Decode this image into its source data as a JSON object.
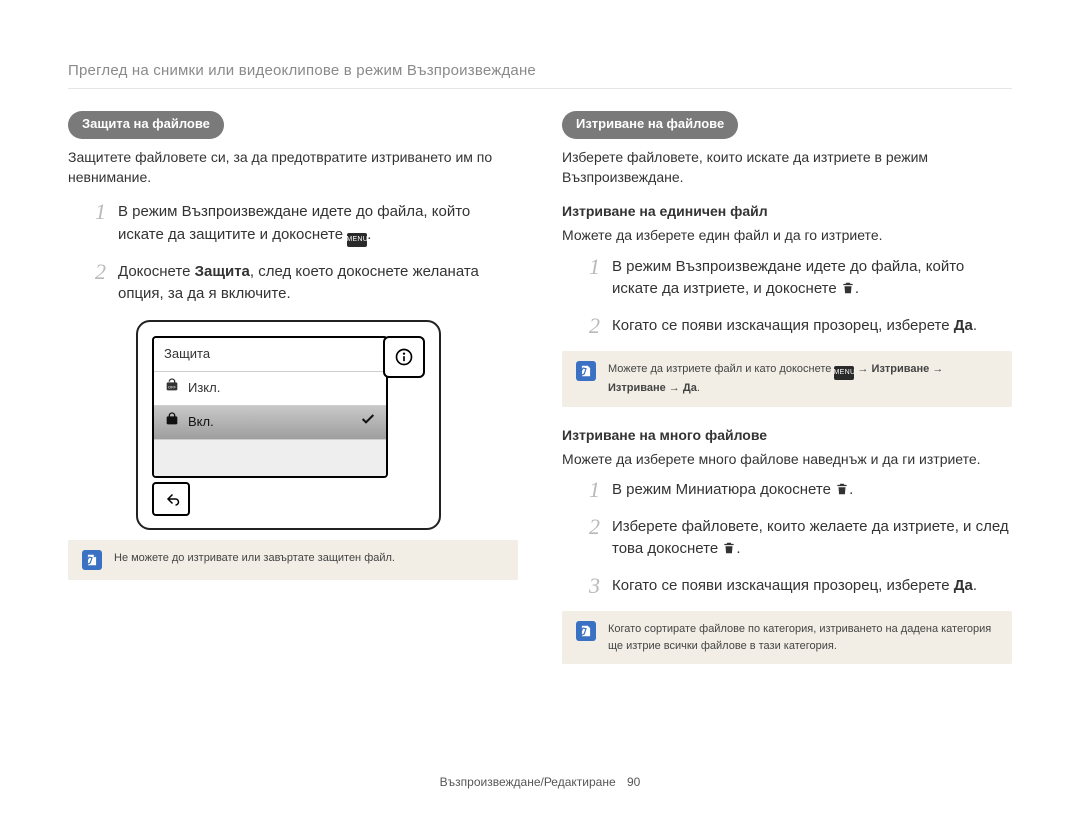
{
  "breadcrumb": "Преглед на снимки или видеоклипове в режим Възпроизвеждане",
  "footer": {
    "text": "Възпроизвеждане/Редактиране",
    "page": "90"
  },
  "left": {
    "pill": "Защита на файлове",
    "lead": "Защитете файловете си, за да предотвратите изтриването им по невнимание.",
    "steps": {
      "s1_num": "1",
      "s1_a": "В режим Възпроизвеждане идете до файла, който искате да защитите и докоснете ",
      "s1_b": ".",
      "s2_num": "2",
      "s2_a": "Докоснете ",
      "s2_bold": "Защита",
      "s2_b": ", след което докоснете желаната опция, за да я включите."
    },
    "device": {
      "title": "Защита",
      "off": "Изкл.",
      "on": "Вкл."
    },
    "tip": "Не можете до изтривате или завъртате защитен файл."
  },
  "right": {
    "pill": "Изтриване на файлове",
    "lead": "Изберете файловете, които искате да изтриете в режим Възпроизвеждане.",
    "single": {
      "heading": "Изтриване на единичен файл",
      "intro": "Можете да изберете един файл и да го изтриете.",
      "s1_num": "1",
      "s1_a": "В режим Възпроизвеждане идете до файла, който искате да изтриете, и докоснете ",
      "s1_b": ".",
      "s2_num": "2",
      "s2_a": "Когато се появи изскачащия прозорец, изберете ",
      "s2_bold": "Да",
      "s2_b": "."
    },
    "tip1_a": "Можете да изтриете файл и като докоснете ",
    "tip1_b": " → ",
    "tip1_c": "Изтриване",
    "tip1_d": " → ",
    "tip1_e": "Изтриване",
    "tip1_f": " → ",
    "tip1_g": "Да",
    "tip1_h": ".",
    "multi": {
      "heading": "Изтриване на много файлове",
      "intro": "Можете да изберете много файлове наведнъж и да ги изтриете.",
      "s1_num": "1",
      "s1_a": "В режим Миниатюра докоснете ",
      "s1_b": ".",
      "s2_num": "2",
      "s2_a": "Изберете файловете, които желаете да изтриете, и след това докоснете ",
      "s2_b": ".",
      "s3_num": "3",
      "s3_a": "Когато се появи изскачащия прозорец, изберете ",
      "s3_bold": "Да",
      "s3_b": "."
    },
    "tip2": "Когато сортирате файлове по категория, изтриването на дадена категория ще изтрие всички файлове в тази категория."
  },
  "icons": {
    "menu_label": "MENU"
  }
}
